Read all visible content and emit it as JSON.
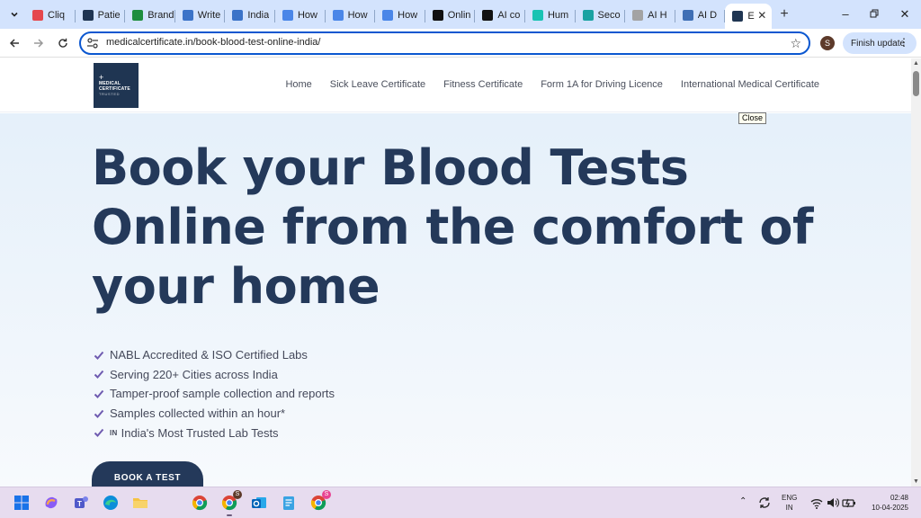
{
  "browser": {
    "tabs": [
      {
        "label": "Cliq",
        "color": "#e5484d"
      },
      {
        "label": "Patie",
        "color": "#1f3552"
      },
      {
        "label": "Brand",
        "color": "#1e8e3e"
      },
      {
        "label": "Write",
        "color": "#3b73c8"
      },
      {
        "label": "India",
        "color": "#3b73c8"
      },
      {
        "label": "How",
        "color": "#4a86e8"
      },
      {
        "label": "How",
        "color": "#4a86e8"
      },
      {
        "label": "How",
        "color": "#4a86e8"
      },
      {
        "label": "Onlin",
        "color": "#111111"
      },
      {
        "label": "AI co",
        "color": "#111111"
      },
      {
        "label": "Hum",
        "color": "#19c3b3"
      },
      {
        "label": "Seco",
        "color": "#1aa2a2"
      },
      {
        "label": "AI H",
        "color": "#a3a3a3"
      },
      {
        "label": "AI D",
        "color": "#3f6fb5"
      },
      {
        "label": "E",
        "color": "#1f3552"
      }
    ],
    "url": "medicalcertificate.in/book-blood-test-online-india/",
    "profile_initial": "S",
    "finish_update_label": "Finish update"
  },
  "site": {
    "logo": {
      "plus": "+",
      "line1": "MEDICAL",
      "line2": "CERTIFICATE",
      "line3": "TRUSTED"
    },
    "nav": [
      "Home",
      "Sick Leave Certificate",
      "Fitness Certificate",
      "Form 1A for Driving Licence",
      "International Medical Certificate"
    ],
    "hero": {
      "title": "Book your Blood Tests Online from the comfort of your home",
      "features": [
        {
          "flag": "",
          "text": "NABL Accredited & ISO Certified Labs"
        },
        {
          "flag": "",
          "text": "Serving 220+ Cities across India"
        },
        {
          "flag": "",
          "text": "Tamper-proof sample collection and reports"
        },
        {
          "flag": "",
          "text": "Samples collected within an hour*"
        },
        {
          "flag": "IN",
          "text": "India's Most Trusted Lab Tests"
        }
      ],
      "cta": "BOOK A TEST"
    },
    "tooltip": "Close",
    "accent_color": "#24395a",
    "check_color": "#6f5bb0"
  },
  "taskbar": {
    "chrome_badge_1": "S",
    "chrome_badge_2": "S",
    "lang_line1": "ENG",
    "lang_line2": "IN",
    "time": "02:48",
    "date": "10-04-2025"
  }
}
